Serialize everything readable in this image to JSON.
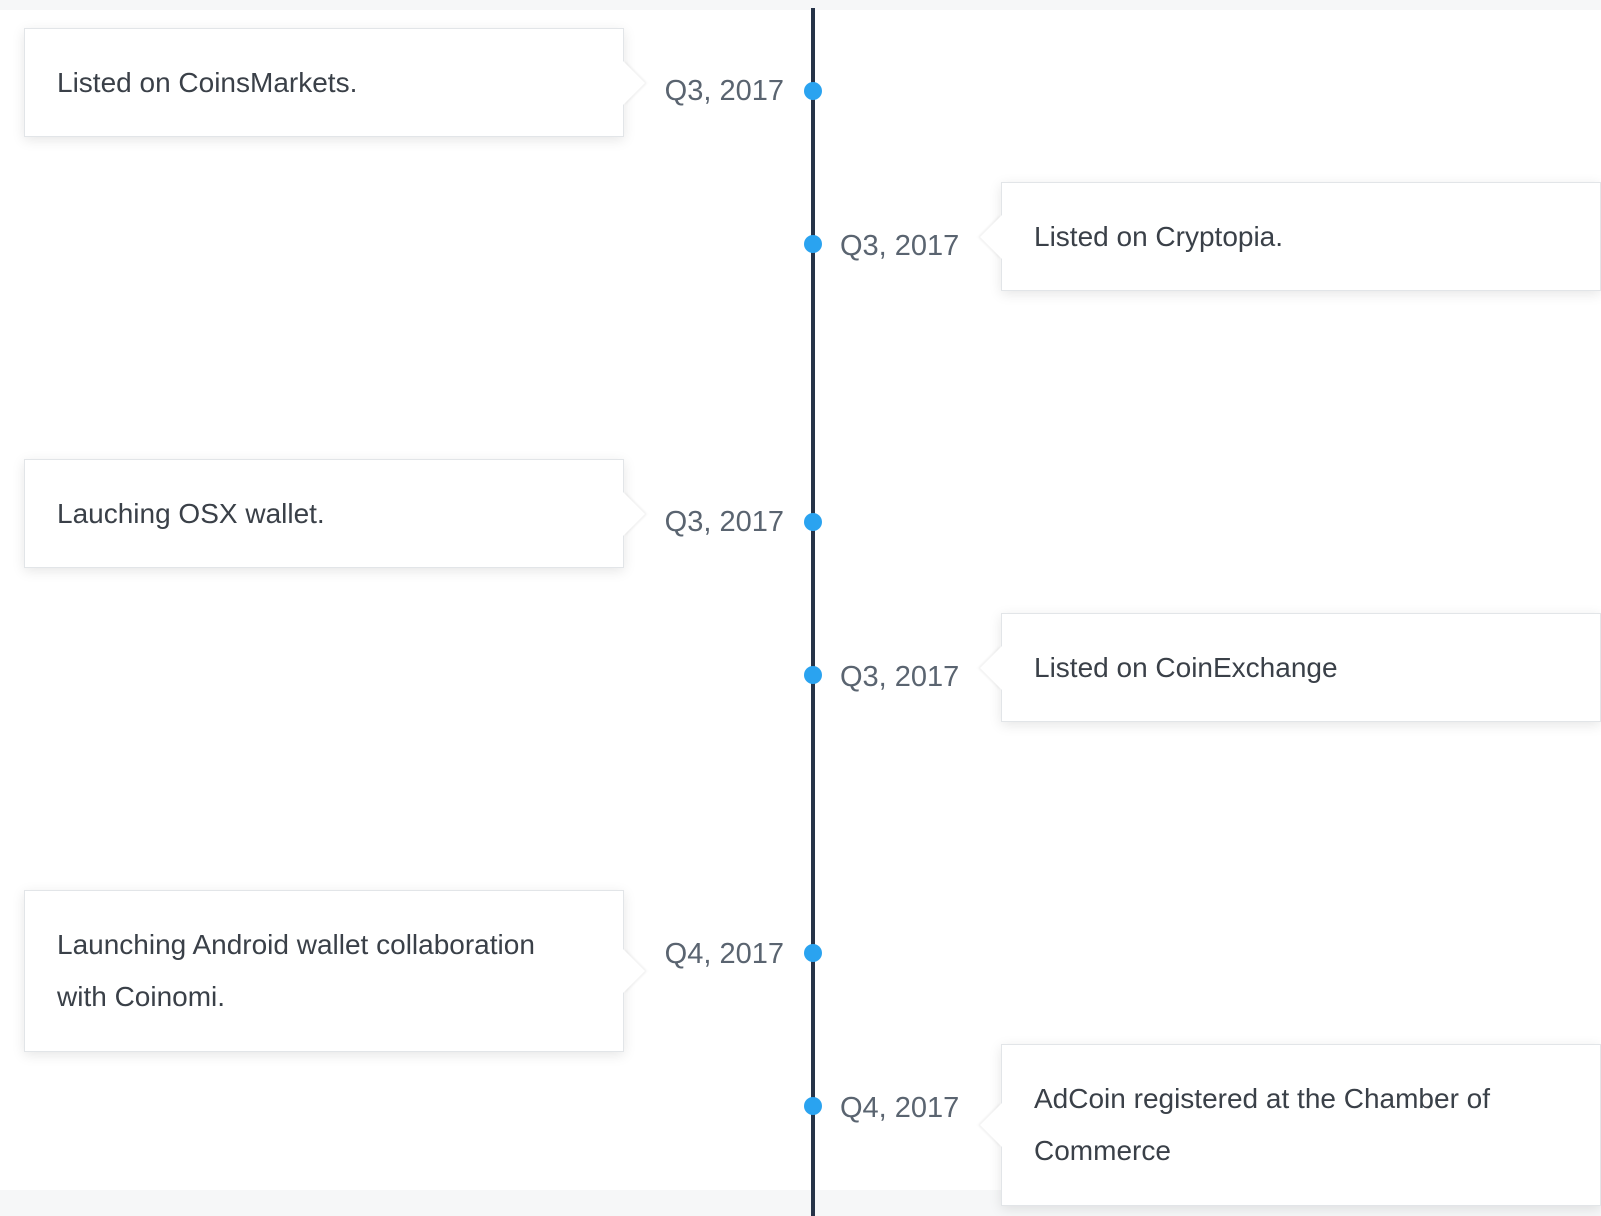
{
  "accent_color": "#2aa3f0",
  "line_color": "#263348",
  "events": [
    {
      "date": "Q3, 2017",
      "text": "Listed on CoinsMarkets."
    },
    {
      "date": "Q3, 2017",
      "text": "Listed on Cryptopia."
    },
    {
      "date": "Q3, 2017",
      "text": "Lauching OSX wallet."
    },
    {
      "date": "Q3, 2017",
      "text": "Listed on CoinExchange"
    },
    {
      "date": "Q4, 2017",
      "text": "Launching Android wallet collaboration with Coinomi."
    },
    {
      "date": "Q4, 2017",
      "text": "AdCoin registered at the Chamber of Commerce"
    }
  ]
}
